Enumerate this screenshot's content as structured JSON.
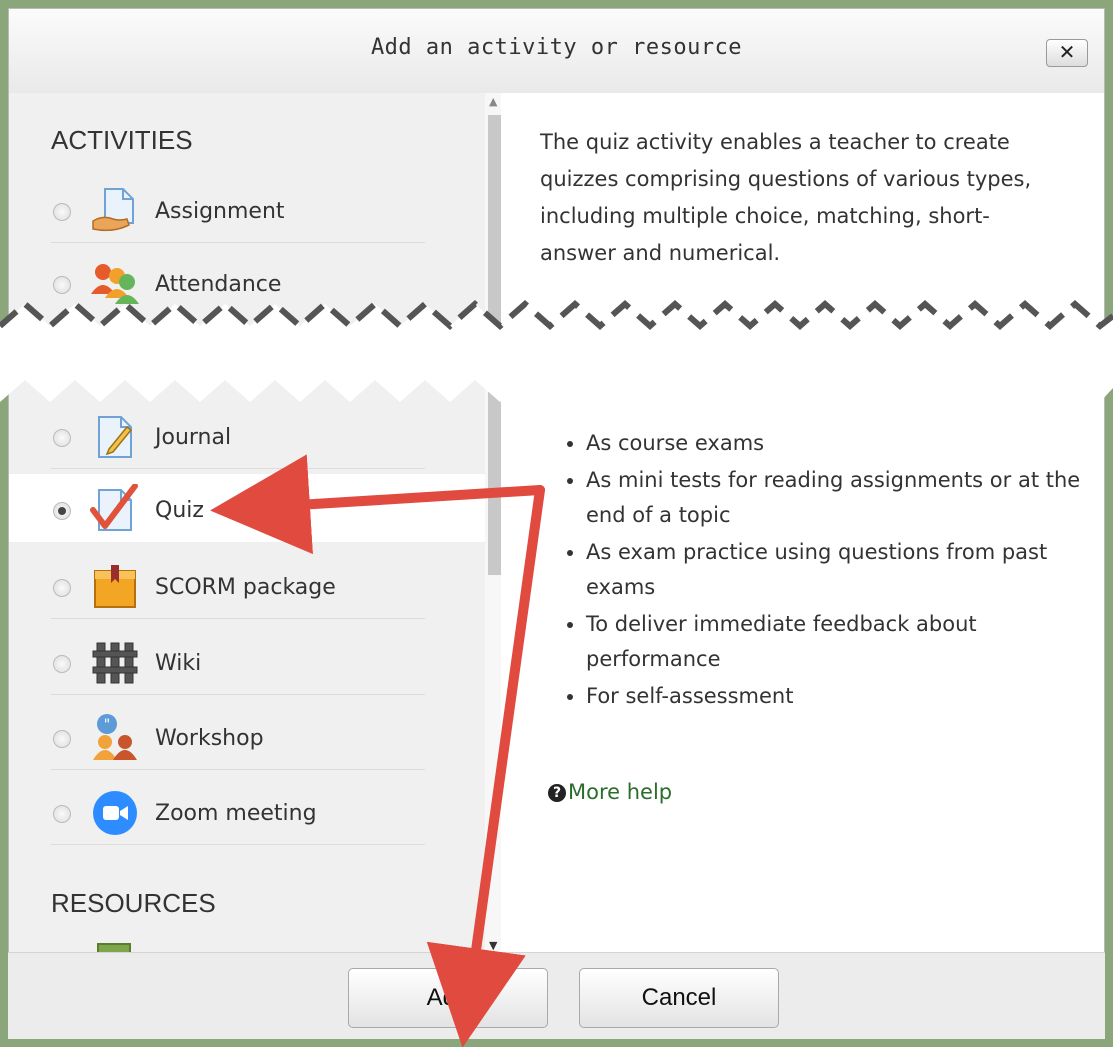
{
  "dialog": {
    "title": "Add an activity or resource",
    "close_label": "✕"
  },
  "left": {
    "activities_heading": "ACTIVITIES",
    "resources_heading": "RESOURCES",
    "modules": [
      {
        "label": "Assignment",
        "icon": "assignment-icon",
        "selected": false
      },
      {
        "label": "Attendance",
        "icon": "attendance-icon",
        "selected": false
      },
      {
        "label": "Journal",
        "icon": "journal-icon",
        "selected": false
      },
      {
        "label": "Quiz",
        "icon": "quiz-icon",
        "selected": true
      },
      {
        "label": "SCORM package",
        "icon": "scorm-package-icon",
        "selected": false
      },
      {
        "label": "Wiki",
        "icon": "wiki-icon",
        "selected": false
      },
      {
        "label": "Workshop",
        "icon": "workshop-icon",
        "selected": false
      },
      {
        "label": "Zoom meeting",
        "icon": "zoom-meeting-icon",
        "selected": false
      }
    ]
  },
  "right": {
    "intro_lines": [
      "The quiz activity enables a teacher to create",
      "quizzes comprising questions of various types,",
      "including multiple choice, matching, short-",
      "answer and numerical."
    ],
    "bullets": [
      "As course exams",
      "As mini tests for reading assignments or at the end of a topic",
      "As exam practice using questions from past exams",
      "To deliver immediate feedback about performance",
      "For self-assessment"
    ],
    "more_help": "More help"
  },
  "footer": {
    "add_label": "Add",
    "cancel_label": "Cancel"
  },
  "colors": {
    "arrow": "#e04a3f",
    "selected_row": "#ffffff",
    "help_link": "#2b6e2b"
  }
}
